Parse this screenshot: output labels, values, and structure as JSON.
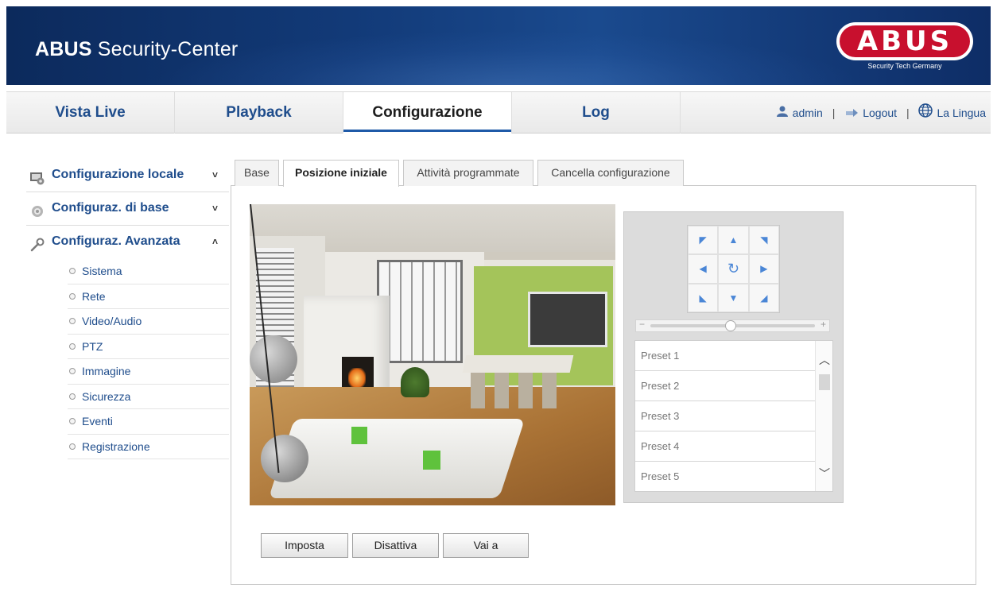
{
  "header": {
    "app_title_bold": "ABUS",
    "app_title_rest": " Security-Center",
    "logo_text": "ABUS",
    "logo_tagline": "Security Tech Germany",
    "brand_red": "#c8102e",
    "banner_blue": "#123a78"
  },
  "nav": {
    "tabs": [
      {
        "label": "Vista Live"
      },
      {
        "label": "Playback"
      },
      {
        "label": "Configurazione"
      },
      {
        "label": "Log"
      }
    ],
    "active_tab": "Configurazione",
    "user": "admin",
    "logout": "Logout",
    "language": "La Lingua",
    "separator": "|"
  },
  "sidebar": {
    "sections": [
      {
        "label": "Configurazione locale",
        "icon": "local-config-icon",
        "chevron": "˅"
      },
      {
        "label": "Configuraz. di base",
        "icon": "basic-config-gear-icon",
        "chevron": "˅"
      },
      {
        "label": "Configuraz. Avanzata",
        "icon": "wrench-icon",
        "chevron": "˄"
      }
    ],
    "items": [
      {
        "label": "Sistema"
      },
      {
        "label": "Rete"
      },
      {
        "label": "Video/Audio"
      },
      {
        "label": "PTZ"
      },
      {
        "label": "Immagine"
      },
      {
        "label": "Sicurezza"
      },
      {
        "label": "Eventi"
      },
      {
        "label": "Registrazione"
      }
    ]
  },
  "content": {
    "tabs": [
      {
        "label": "Base"
      },
      {
        "label": "Posizione iniziale"
      },
      {
        "label": "Attività programmate"
      },
      {
        "label": "Cancella configurazione"
      }
    ],
    "active_tab": "Posizione iniziale"
  },
  "ptz": {
    "zoom_minus": "−",
    "zoom_plus": "+",
    "zoom_level": 0.48,
    "presets": [
      {
        "label": "Preset 1"
      },
      {
        "label": "Preset 2"
      },
      {
        "label": "Preset 3"
      },
      {
        "label": "Preset 4"
      },
      {
        "label": "Preset 5"
      }
    ]
  },
  "buttons": {
    "set": "Imposta",
    "disable": "Disattiva",
    "goto": "Vai a"
  }
}
